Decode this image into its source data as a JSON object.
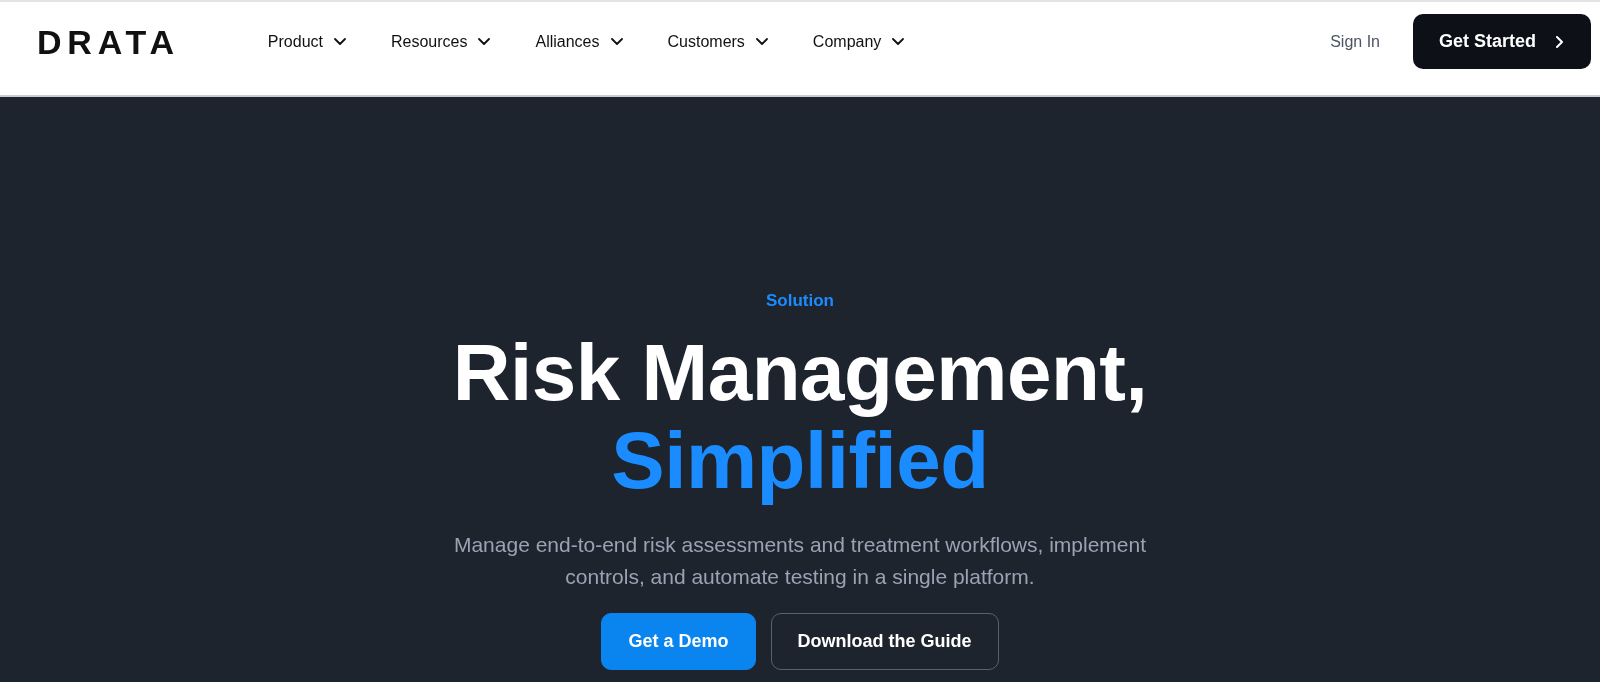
{
  "header": {
    "logo": "DRATA",
    "nav": [
      {
        "label": "Product"
      },
      {
        "label": "Resources"
      },
      {
        "label": "Alliances"
      },
      {
        "label": "Customers"
      },
      {
        "label": "Company"
      }
    ],
    "sign_in": "Sign In",
    "cta": "Get Started"
  },
  "hero": {
    "eyebrow": "Solution",
    "title": [
      {
        "text": "Risk Management,",
        "highlight": false
      },
      {
        "text": "Simplified",
        "highlight": true
      }
    ],
    "description": "Manage end-to-end risk assessments and treatment workflows, implement controls, and automate testing in a single platform.",
    "buttons": [
      {
        "label": "Get a Demo",
        "kind": "primary"
      },
      {
        "label": "Download the Guide",
        "kind": "outline"
      }
    ]
  }
}
